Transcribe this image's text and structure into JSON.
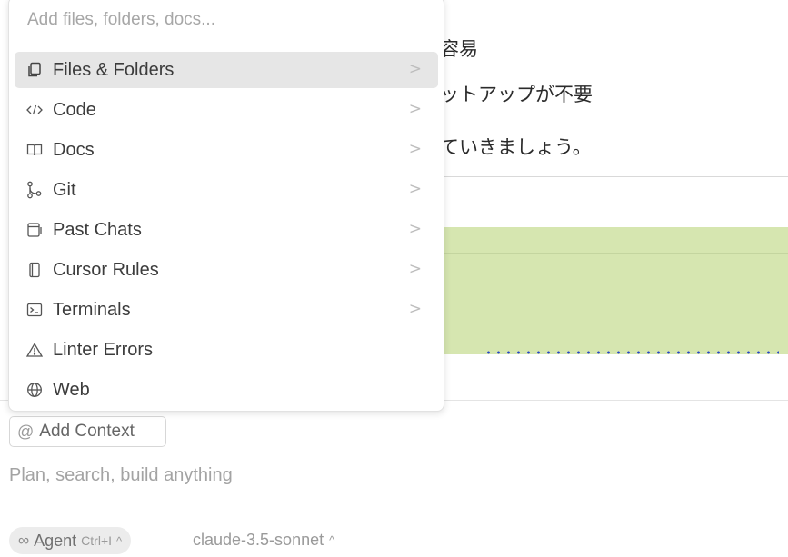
{
  "background": {
    "line1": "容易",
    "line2": "ットアップが不要",
    "line3": "ていきましょう。"
  },
  "popup": {
    "search_placeholder": "Add files, folders, docs...",
    "items": [
      {
        "label": "Files & Folders",
        "icon": "files-icon",
        "has_submenu": true,
        "active": true
      },
      {
        "label": "Code",
        "icon": "code-icon",
        "has_submenu": true
      },
      {
        "label": "Docs",
        "icon": "book-icon",
        "has_submenu": true
      },
      {
        "label": "Git",
        "icon": "git-icon",
        "has_submenu": true
      },
      {
        "label": "Past Chats",
        "icon": "chat-history-icon",
        "has_submenu": true
      },
      {
        "label": "Cursor Rules",
        "icon": "rules-icon",
        "has_submenu": true
      },
      {
        "label": "Terminals",
        "icon": "terminal-icon",
        "has_submenu": true
      },
      {
        "label": "Linter Errors",
        "icon": "warning-icon",
        "has_submenu": false
      },
      {
        "label": "Web",
        "icon": "globe-icon",
        "has_submenu": false
      }
    ],
    "chevron": ">"
  },
  "composer": {
    "at_symbol": "@",
    "add_context_label": "Add Context",
    "placeholder": "Plan, search, build anything",
    "agent_symbol": "∞",
    "agent_label": "Agent",
    "agent_shortcut": "Ctrl+I",
    "caret": "^",
    "model_label": "claude-3.5-sonnet"
  }
}
